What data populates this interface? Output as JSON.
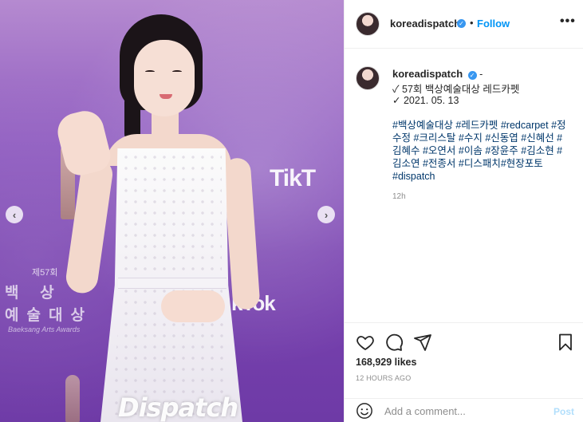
{
  "photo": {
    "bg_texts": {
      "tiktok_top": "TikT",
      "tiktok_bottom": "kTok",
      "award_num": "제57회",
      "award_ko_line1": "백  상",
      "award_ko_line2": "예술대상",
      "award_en": "Baeksang Arts Awards"
    },
    "watermark": "Dispatch",
    "watermark_sub": "DISPATCH"
  },
  "carousel": {
    "prev_glyph": "‹",
    "next_glyph": "›"
  },
  "header": {
    "username": "koreadispatch",
    "verified_glyph": "✓",
    "separator": "•",
    "follow_label": "Follow",
    "more_glyph": "•••"
  },
  "caption": {
    "username": "koreadispatch",
    "verified_glyph": "✓",
    "suffix": "-",
    "line1": "✓ 57회 백상예술대상 레드카펫",
    "line2": "✓ 2021. 05. 13",
    "hashtags": "#백상예술대상 #레드카펫 #redcarpet #정수정 #크리스탈 #수지 #신동엽 #신혜선 #김혜수 #오연서 #이솜 #장윤주 #김소현 #김소연 #전종서 #디스패치#현장포토#dispatch",
    "time": "12h"
  },
  "actions": {
    "icons": [
      "heart-icon",
      "comment-icon",
      "share-icon",
      "bookmark-icon"
    ],
    "likes": "168,929 likes",
    "ago": "12 HOURS AGO"
  },
  "comment_bar": {
    "placeholder": "Add a comment...",
    "post_label": "Post"
  },
  "colors": {
    "accent": "#0095f6",
    "verified": "#3897f0",
    "hashtag": "#00376b",
    "muted": "#8e8e8e",
    "post_disabled": "#b2dffc"
  }
}
